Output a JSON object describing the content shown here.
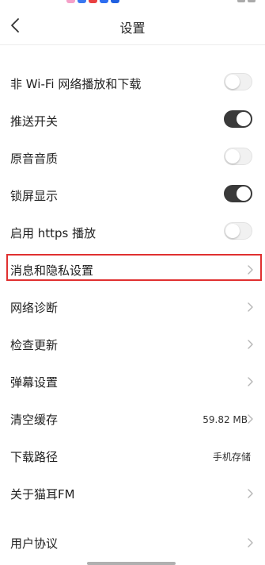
{
  "status_bar": {
    "dot_colors": [
      "#f5a0c8",
      "#3a78f0",
      "#e94040",
      "#2d6df0",
      "#2060e0"
    ]
  },
  "header": {
    "title": "设置",
    "back_icon": "chevron-left-icon"
  },
  "settings": [
    {
      "id": "non-wifi",
      "label": "非 Wi-Fi 网络播放和下载",
      "type": "toggle",
      "on": false
    },
    {
      "id": "push",
      "label": "推送开关",
      "type": "toggle",
      "on": true
    },
    {
      "id": "original-audio",
      "label": "原音音质",
      "type": "toggle",
      "on": false
    },
    {
      "id": "lockscreen",
      "label": "锁屏显示",
      "type": "toggle",
      "on": true
    },
    {
      "id": "https",
      "label": "启用 https 播放",
      "type": "toggle",
      "on": false
    },
    {
      "id": "privacy",
      "label": "消息和隐私设置",
      "type": "link",
      "highlighted": true
    },
    {
      "id": "network-diagnosis",
      "label": "网络诊断",
      "type": "link"
    },
    {
      "id": "check-update",
      "label": "检查更新",
      "type": "link"
    },
    {
      "id": "danmaku",
      "label": "弹幕设置",
      "type": "link"
    },
    {
      "id": "clear-cache",
      "label": "清空缓存",
      "type": "link",
      "value": "59.82 MB"
    },
    {
      "id": "download-path",
      "label": "下载路径",
      "type": "value",
      "value": "手机存储"
    },
    {
      "id": "about",
      "label": "关于猫耳FM",
      "type": "link"
    },
    {
      "id": "user-agreement",
      "label": "用户协议",
      "type": "link"
    }
  ],
  "colors": {
    "toggle_on": "#3a3a3a",
    "toggle_off": "#f1f1f1",
    "highlight": "#e03030"
  }
}
